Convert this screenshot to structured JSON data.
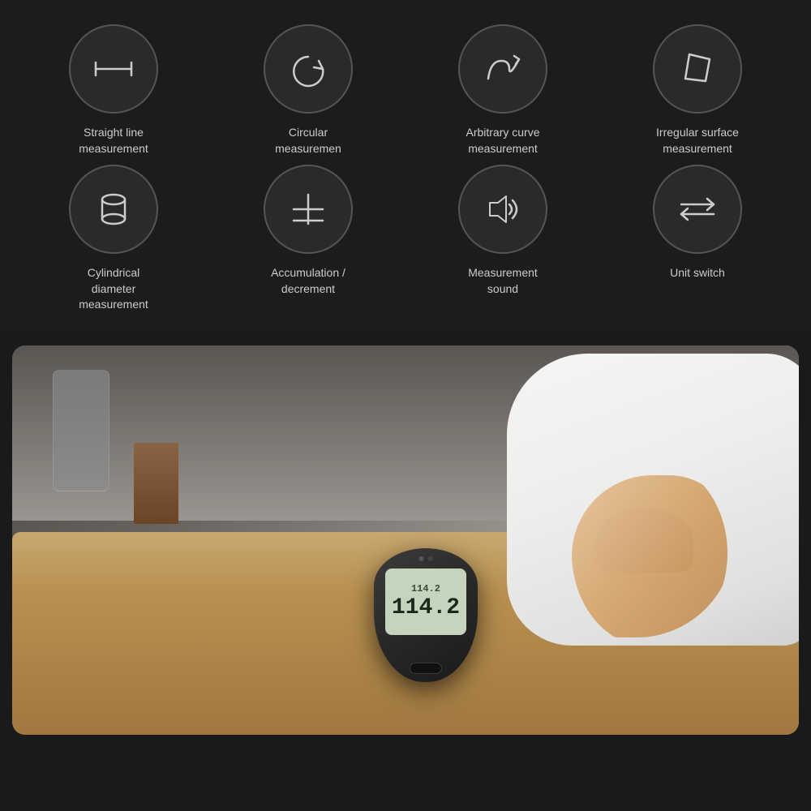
{
  "background": "#1c1c1c",
  "icons_row1": [
    {
      "id": "straight-line",
      "label": "Straight line\nmeasurement",
      "icon_type": "straight-line"
    },
    {
      "id": "circular",
      "label": "Circular\nmeasuremen",
      "icon_type": "circular"
    },
    {
      "id": "arbitrary-curve",
      "label": "Arbitrary curve\nmeasurement",
      "icon_type": "arbitrary-curve"
    },
    {
      "id": "irregular-surface",
      "label": "Irregular surface\nmeasurement",
      "icon_type": "irregular-surface"
    }
  ],
  "icons_row2": [
    {
      "id": "cylindrical",
      "label": "Cylindrical\ndiameter\nmeasurement",
      "icon_type": "cylindrical"
    },
    {
      "id": "accumulation",
      "label": "Accumulation /\ndecrement",
      "icon_type": "accumulation"
    },
    {
      "id": "measurement-sound",
      "label": "Measurement\nsound",
      "icon_type": "sound"
    },
    {
      "id": "unit-switch",
      "label": "Unit switch",
      "icon_type": "unit-switch"
    }
  ],
  "device": {
    "screen_top": "114.2",
    "screen_main": "114.2"
  }
}
